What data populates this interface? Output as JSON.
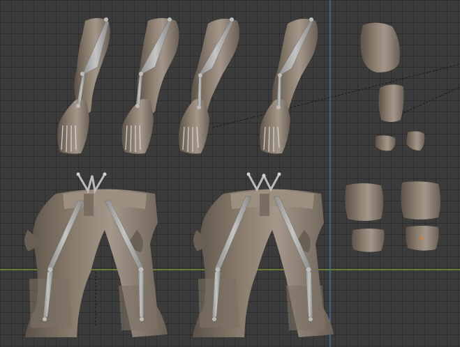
{
  "viewport": {
    "background": "#3b3b3b",
    "grid_color": "#2a2a2a",
    "x_axis_color": "#7fa232",
    "y_axis_color": "#3f7fc2",
    "mesh_color": "#8a7d6e",
    "mesh_shadow": "#5c5248",
    "mesh_highlight": "#b8ab9a",
    "bone_color": "#a9a9a9",
    "bone_edge": "#6d6d6d",
    "origin_marker_color": "#e07a2e"
  },
  "objects": {
    "arms": [
      "arm-1",
      "arm-2",
      "arm-3",
      "arm-4"
    ],
    "legs": [
      "legs-left-pair",
      "legs-right-pair"
    ],
    "armor_pieces": [
      "pauldron",
      "bracer",
      "hand-piece-left",
      "hand-piece-right",
      "knee-pad-upper-left",
      "knee-pad-upper-right",
      "knee-pad-lower-left",
      "knee-pad-lower-right"
    ]
  }
}
